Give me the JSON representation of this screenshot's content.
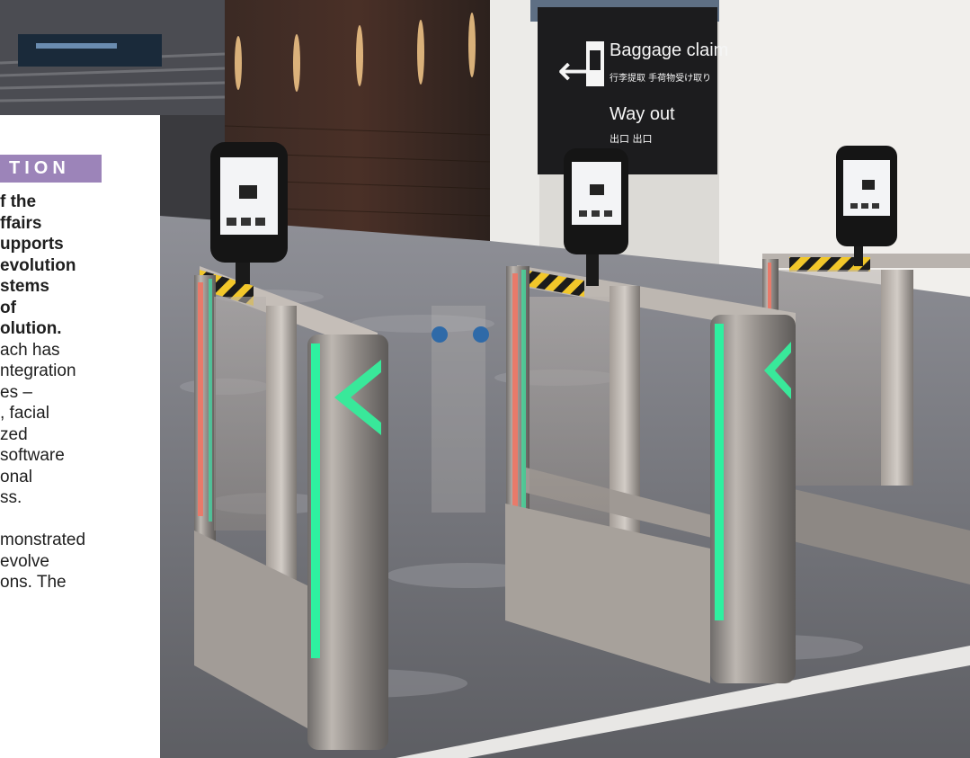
{
  "page": {
    "section_tag": "TION",
    "lead_lines": [
      "f the",
      "ffairs",
      "upports",
      " evolution",
      "stems",
      "of",
      "olution."
    ],
    "body_lines_1": [
      "ach has",
      "ntegration",
      "es –",
      ", facial",
      "zed",
      " software",
      "onal",
      "ss."
    ],
    "body_lines_2": [
      "monstrated",
      "evolve",
      "ons. The"
    ]
  },
  "photo": {
    "sign": {
      "title": "Baggage claim",
      "title_jp": "行李提取  手荷物受け取り",
      "subtitle": "Way out",
      "subtitle_jp": "出口 出口"
    }
  },
  "colors": {
    "accent_purple": "#9c84b9",
    "gate_arrow_green": "#39e89a",
    "light_red": "#e87a6a"
  }
}
